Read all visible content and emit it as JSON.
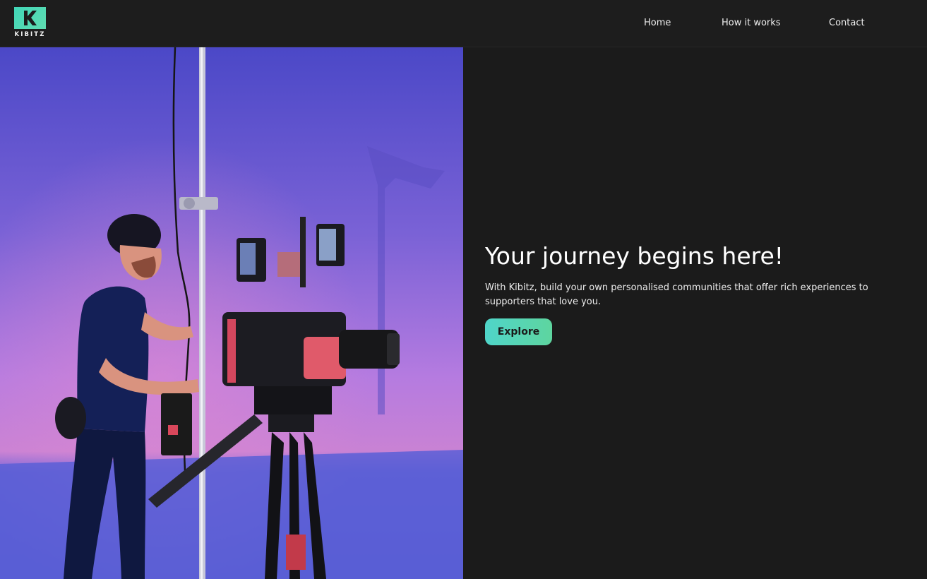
{
  "brand": {
    "name": "KIBITZ",
    "accent": "#4fd5c9",
    "accent_end": "#5ed59f"
  },
  "nav": {
    "items": [
      {
        "label": "Home"
      },
      {
        "label": "How it works"
      },
      {
        "label": "Contact"
      }
    ]
  },
  "hero": {
    "title": "Your journey begins here!",
    "text": "With Kibitz, build your own personalised communities that offer rich experiences to supporters that love you.",
    "cta_label": "Explore"
  },
  "image": {
    "subject": "camera-operator-photo"
  }
}
